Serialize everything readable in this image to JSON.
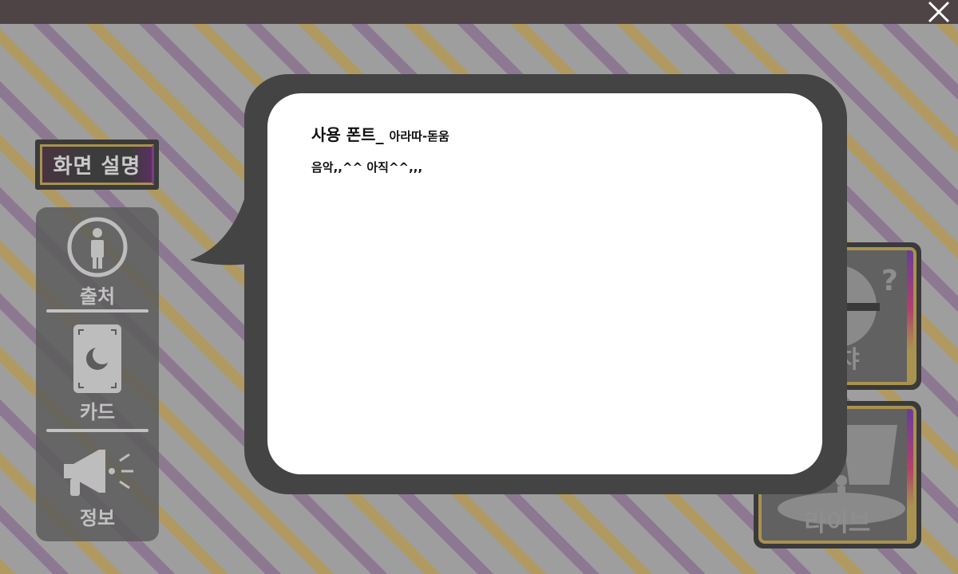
{
  "dialog": {
    "font_label": "사용 폰트_",
    "font_name": "아라따-돋움",
    "music_line": "음악,,^^ 아직^^,,,"
  },
  "sidebar": {
    "title": "화면 설명",
    "items": [
      {
        "label": "출처",
        "icon": "person-info-icon"
      },
      {
        "label": "카드",
        "icon": "moon-card-icon"
      },
      {
        "label": "정보",
        "icon": "megaphone-icon"
      }
    ]
  },
  "right_cards": [
    {
      "label": "가챠",
      "icon": "gacha-ball-icon"
    },
    {
      "label": "라이브",
      "icon": "live-stage-icon"
    }
  ],
  "colors": {
    "topbar": "#4e4446",
    "stripe_gold": "#c5a24a",
    "stripe_purple": "#8e6e96",
    "bubble_dark": "#444444",
    "panel_gray": "#5c5c5c"
  }
}
